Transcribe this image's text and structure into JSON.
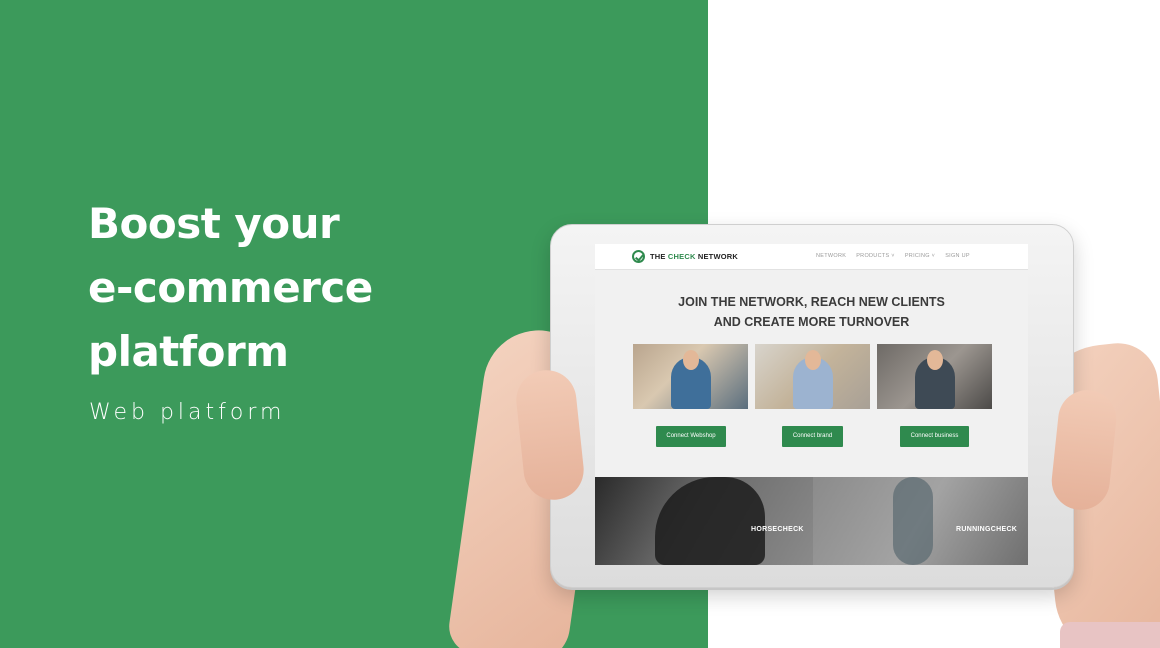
{
  "left_panel": {
    "headline": [
      "Boost your",
      "e-commerce",
      "platform"
    ],
    "subheading": "Web platform",
    "background_color": "#3c9a5b"
  },
  "tablet_site": {
    "brand": {
      "prefix": "THE ",
      "highlight": "CHECK",
      "suffix": " NETWORK",
      "accent_color": "#2f8a4e"
    },
    "nav": [
      "NETWORK",
      "PRODUCTS ˅",
      "PRICING ˅",
      "SIGN UP"
    ],
    "hero": [
      "JOIN THE NETWORK, REACH NEW CLIENTS",
      "AND CREATE MORE TURNOVER"
    ],
    "buttons": [
      "Connect Webshop",
      "Connect brand",
      "Connect business"
    ],
    "tiles": [
      "HORSECHECK",
      "RUNNINGCHECK"
    ]
  }
}
